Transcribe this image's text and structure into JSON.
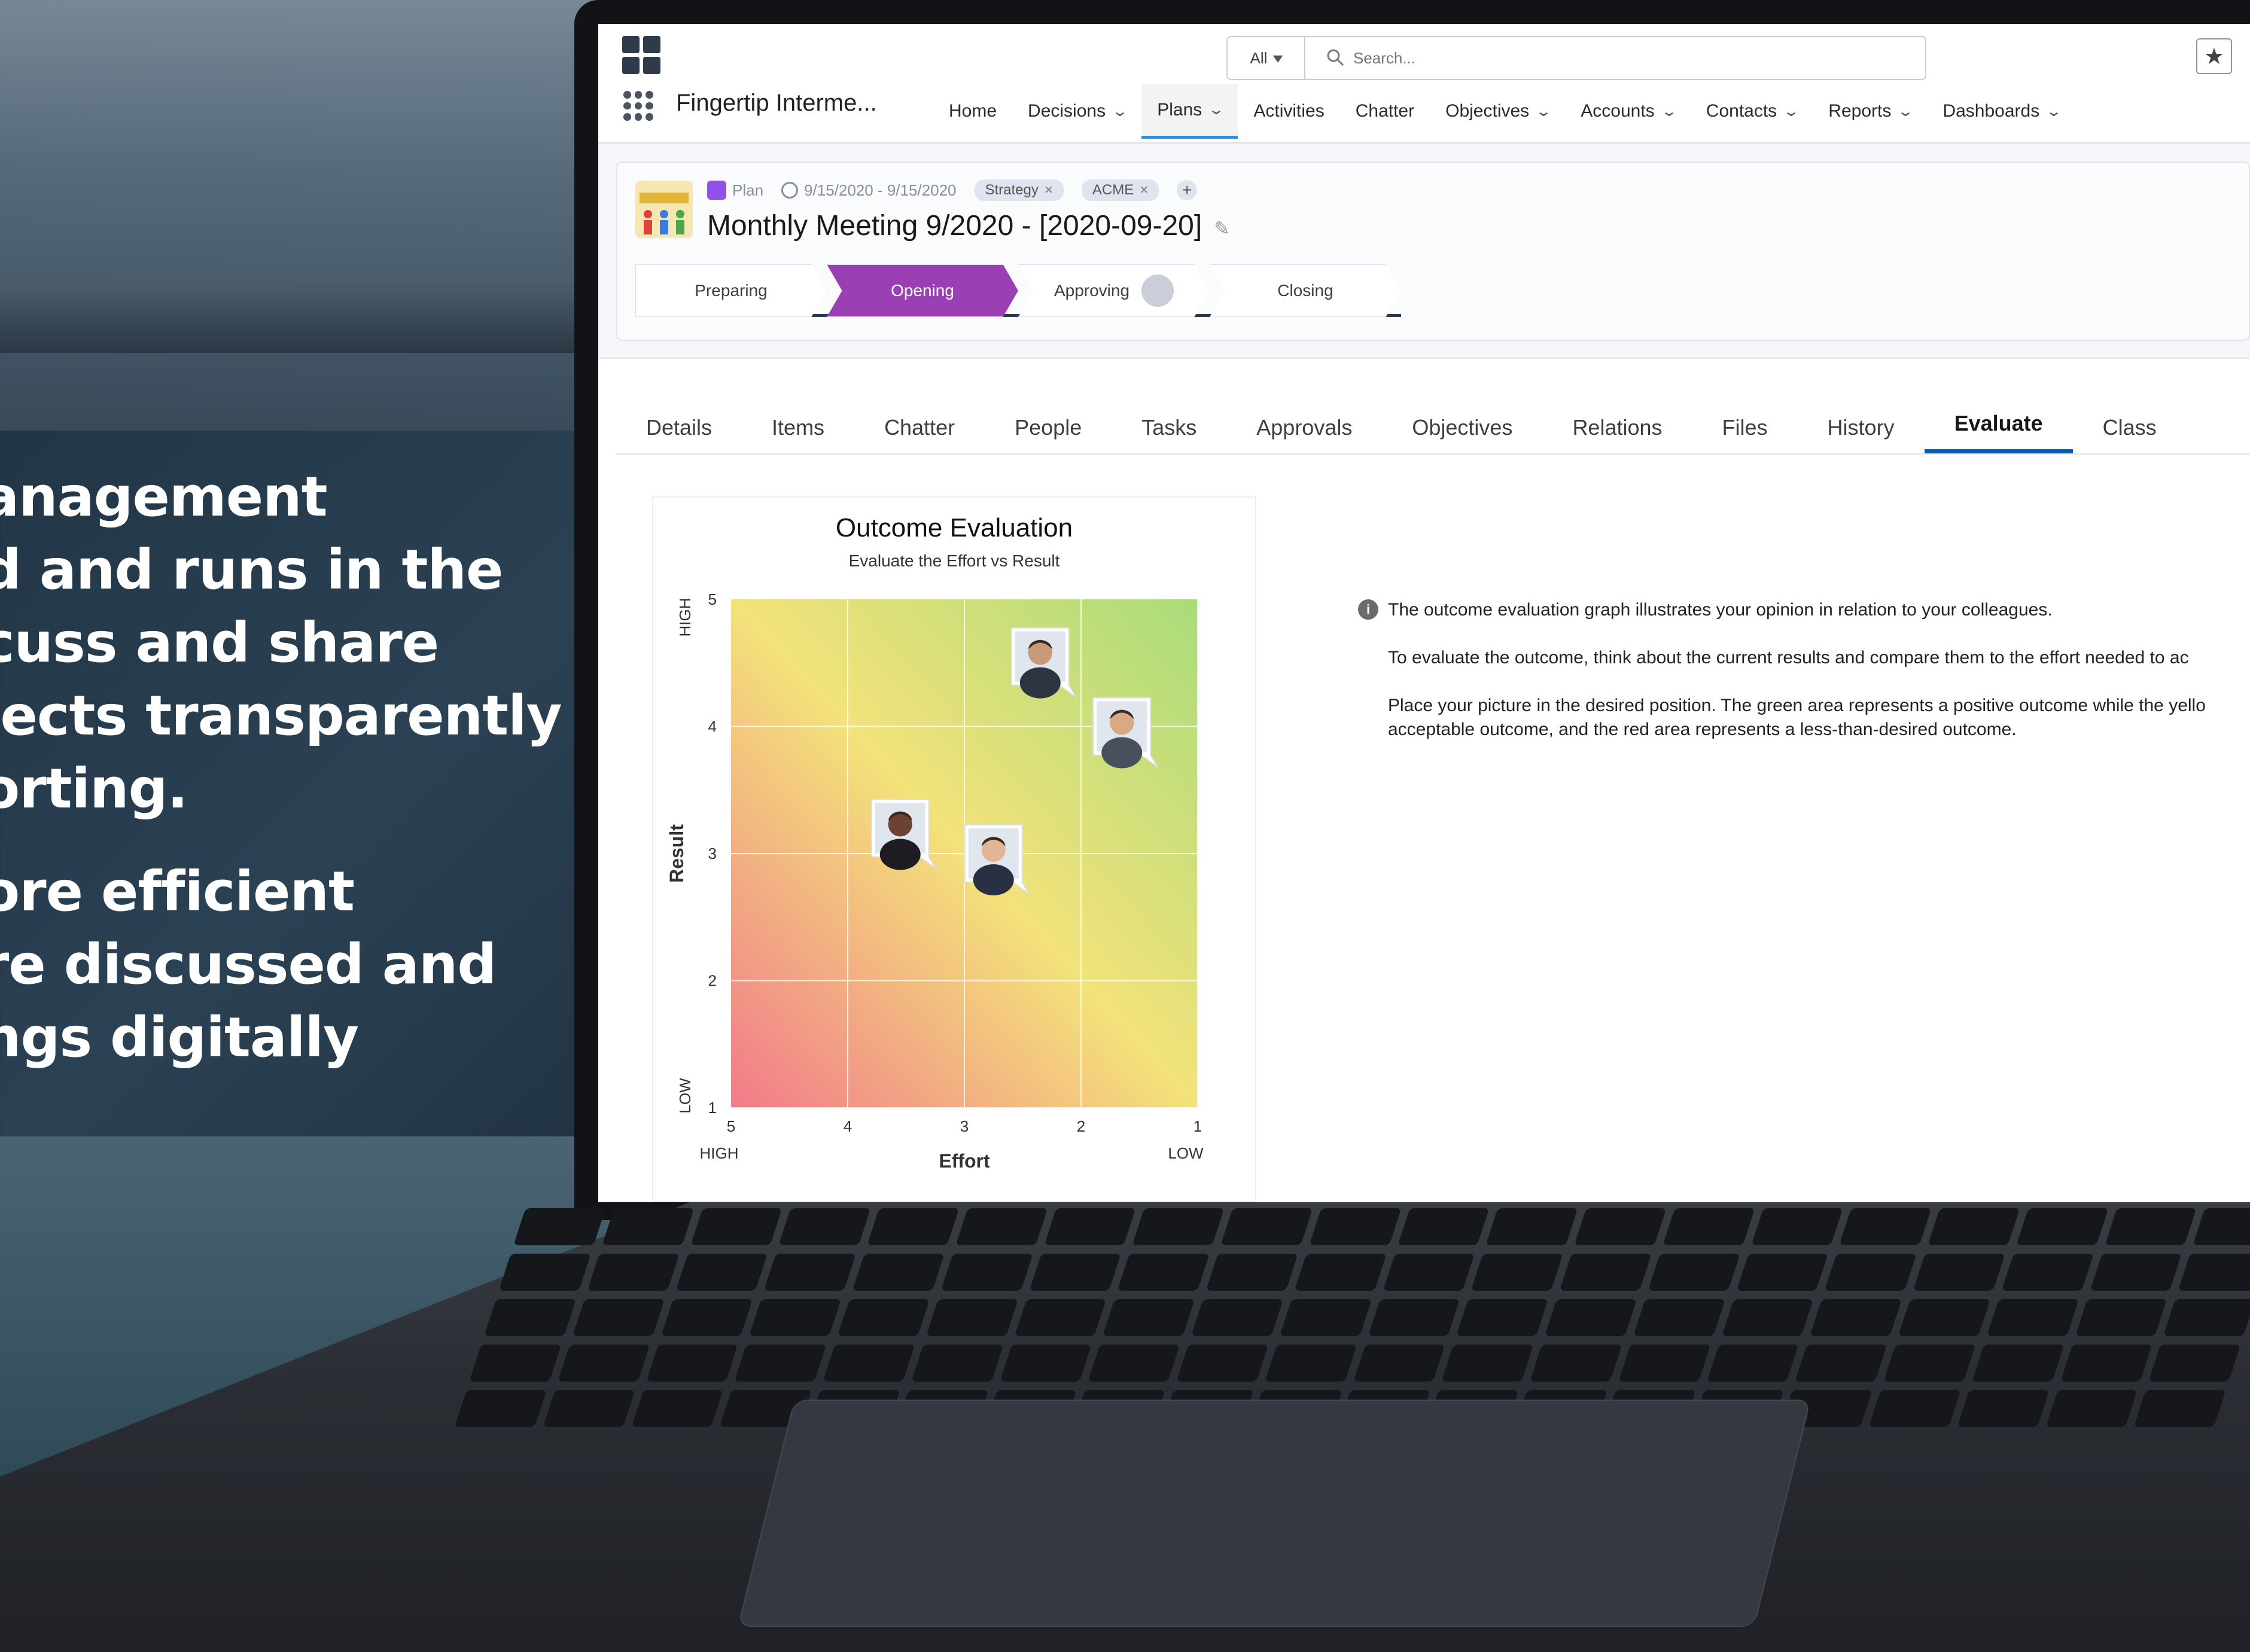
{
  "overlay": {
    "lines1": [
      "anagement",
      "d and runs in the",
      "cuss and share",
      "jects transparently",
      "orting."
    ],
    "lines2": [
      "ore efficient",
      "re discussed and",
      "ngs digitally"
    ]
  },
  "search": {
    "scope": "All",
    "placeholder": "Search..."
  },
  "app": {
    "name": "Fingertip Interme..."
  },
  "nav": [
    {
      "label": "Home",
      "chevron": false
    },
    {
      "label": "Decisions",
      "chevron": true
    },
    {
      "label": "Plans",
      "chevron": true,
      "active": true
    },
    {
      "label": "Activities",
      "chevron": false
    },
    {
      "label": "Chatter",
      "chevron": false
    },
    {
      "label": "Objectives",
      "chevron": true
    },
    {
      "label": "Accounts",
      "chevron": true
    },
    {
      "label": "Contacts",
      "chevron": true
    },
    {
      "label": "Reports",
      "chevron": true
    },
    {
      "label": "Dashboards",
      "chevron": true
    }
  ],
  "record": {
    "type": "Plan",
    "dates": "9/15/2020 - 9/15/2020",
    "tags": [
      "Strategy",
      "ACME"
    ],
    "title": "Monthly Meeting 9/2020 - [2020-09-20]",
    "path": [
      "Preparing",
      "Opening",
      "Approving",
      "Closing"
    ],
    "current_step": 1
  },
  "tabs": [
    "Details",
    "Items",
    "Chatter",
    "People",
    "Tasks",
    "Approvals",
    "Objectives",
    "Relations",
    "Files",
    "History",
    "Evaluate",
    "Class"
  ],
  "active_tab": "Evaluate",
  "info": {
    "p1": "The outcome evaluation graph illustrates your opinion in relation to your colleagues.",
    "p2": "To evaluate the outcome, think about the current results and compare them to the effort needed to ac",
    "p3": "Place your picture in the desired position. The green area represents a positive outcome while the yello acceptable outcome, and the red area represents a less-than-desired outcome."
  },
  "chart_data": {
    "type": "scatter",
    "title": "Outcome Evaluation",
    "subtitle": "Evaluate the Effort vs Result",
    "xlabel": "Effort",
    "ylabel": "Result",
    "x_ticks": [
      5,
      4,
      3,
      2,
      1
    ],
    "y_ticks": [
      1,
      2,
      3,
      4,
      5
    ],
    "x_end_labels": {
      "left": "HIGH",
      "right": "LOW"
    },
    "y_end_labels": {
      "bottom": "LOW",
      "top": "HIGH"
    },
    "xlim": [
      5,
      1
    ],
    "ylim": [
      1,
      5
    ],
    "grid": true,
    "colors": {
      "green": "#a9dc7a",
      "yellow": "#f3e27a",
      "red": "#f27a8a"
    },
    "points": [
      {
        "x": 2.35,
        "y": 4.55
      },
      {
        "x": 1.65,
        "y": 4.0
      },
      {
        "x": 3.55,
        "y": 3.2
      },
      {
        "x": 2.75,
        "y": 3.0
      }
    ]
  }
}
